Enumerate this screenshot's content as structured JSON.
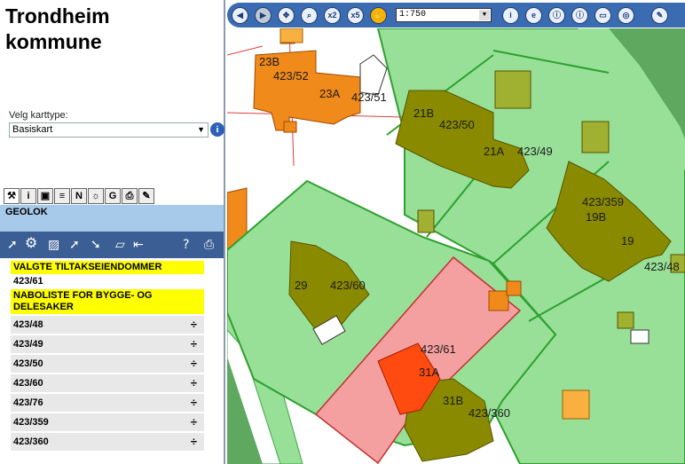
{
  "left_panel": {
    "title": "Trondheim kommune",
    "map_type_label": "Velg karttype:",
    "map_type_value": "Basiskart",
    "layer_label": "GEOLOK",
    "tools_row1": [
      "⚒",
      "i",
      "▣",
      "≡",
      "N",
      "☼",
      "G",
      "⎙",
      "✎"
    ],
    "selected_header": "VALGTE TILTAKSEIENDOMMER",
    "selected_item": "423/61",
    "neighbors_header": "NABOLISTE FOR BYGGE- OG DELESAKER",
    "neighbors": [
      {
        "id": "423/48",
        "action": "÷"
      },
      {
        "id": "423/49",
        "action": "÷"
      },
      {
        "id": "423/50",
        "action": "÷"
      },
      {
        "id": "423/60",
        "action": "÷"
      },
      {
        "id": "423/76",
        "action": "÷"
      },
      {
        "id": "423/359",
        "action": "÷"
      },
      {
        "id": "423/360",
        "action": "÷"
      }
    ]
  },
  "toolbar": {
    "zoom_x2": "x2",
    "zoom_x5": "x5",
    "scale": "1:750",
    "info_i": "i",
    "info_e": "e"
  },
  "map": {
    "labels": [
      {
        "key": "a",
        "text": "23B"
      },
      {
        "key": "b",
        "text": "423/52"
      },
      {
        "key": "c",
        "text": "23A"
      },
      {
        "key": "d",
        "text": "423/51"
      },
      {
        "key": "e",
        "text": "21B"
      },
      {
        "key": "f",
        "text": "423/50"
      },
      {
        "key": "g",
        "text": "21A"
      },
      {
        "key": "h",
        "text": "423/49"
      },
      {
        "key": "i",
        "text": "423/359"
      },
      {
        "key": "j",
        "text": "19B"
      },
      {
        "key": "k",
        "text": "19"
      },
      {
        "key": "l",
        "text": "423/48"
      },
      {
        "key": "m",
        "text": "29"
      },
      {
        "key": "n",
        "text": "423/60"
      },
      {
        "key": "o",
        "text": "423/61"
      },
      {
        "key": "p",
        "text": "31A"
      },
      {
        "key": "q",
        "text": "31B"
      },
      {
        "key": "r",
        "text": "423/360"
      }
    ]
  },
  "colors": {
    "panel_blue": "#3b5f95",
    "layer_blue": "#a7c9ea",
    "highlight_yellow": "#ffff00",
    "parcel_green": "#98e098",
    "selected_parcel": "#f4a0a0",
    "building_olive": "#8a8a00",
    "building_orange": "#f08a1a"
  }
}
